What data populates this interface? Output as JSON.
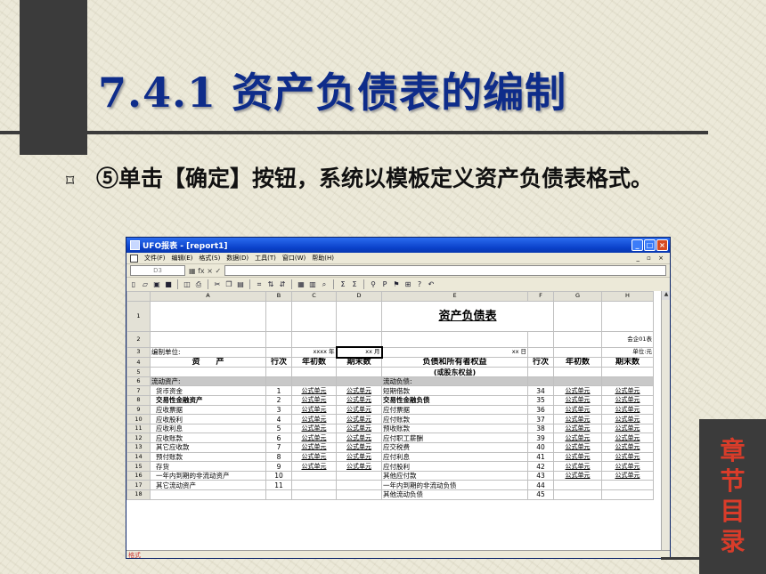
{
  "slide": {
    "title": "7.4.1 资产负债表的编制",
    "bullet_symbol": "⌑",
    "bullet_text": "⑤单击【确定】按钮，系统以模板定义资产负债表格式。",
    "chapter_nav": [
      "章",
      "节",
      "目",
      "录"
    ]
  },
  "app": {
    "title": "UFO报表 - [report1]",
    "menu": [
      "文件(F)",
      "编辑(E)",
      "格式(S)",
      "数据(D)",
      "工具(T)",
      "窗口(W)",
      "帮助(H)"
    ],
    "mdi_controls": "_ ▫ ×",
    "cell_ref": "D3",
    "fx_symbols": "▦ fx × ✓",
    "columns": [
      "A",
      "B",
      "C",
      "D",
      "E",
      "F",
      "G",
      "H"
    ],
    "report_title": "资产负债表",
    "form_code": "会企01表",
    "unit_label": "编制单位:",
    "year_label": "xxxx 年",
    "month_label": "xx 月",
    "day_label": "xx 日",
    "currency_unit": "单位:元",
    "headers": [
      "资　　产",
      "行次",
      "年初数",
      "期末数",
      "负债和所有者权益",
      "行次",
      "年初数",
      "期末数"
    ],
    "header_sub": "(或股东权益)",
    "section_left": "流动资产:",
    "section_right": "流动负债:",
    "formula": "公式单元",
    "rows": [
      {
        "n": "7",
        "a": "货币资金",
        "b": "1",
        "e": "短期借款",
        "f": "34"
      },
      {
        "n": "8",
        "a": "交易性金融资产",
        "b": "2",
        "e": "交易性金融负债",
        "f": "35",
        "bold": true
      },
      {
        "n": "9",
        "a": "应收票据",
        "b": "3",
        "e": "应付票据",
        "f": "36"
      },
      {
        "n": "10",
        "a": "应收股利",
        "b": "4",
        "e": "应付账款",
        "f": "37"
      },
      {
        "n": "11",
        "a": "应收利息",
        "b": "5",
        "e": "预收账款",
        "f": "38"
      },
      {
        "n": "12",
        "a": "应收账款",
        "b": "6",
        "e": "应付职工薪酬",
        "f": "39"
      },
      {
        "n": "13",
        "a": "其它应收款",
        "b": "7",
        "e": "应交税费",
        "f": "40"
      },
      {
        "n": "14",
        "a": "预付账款",
        "b": "8",
        "e": "应付利息",
        "f": "41"
      },
      {
        "n": "15",
        "a": "存货",
        "b": "9",
        "e": "应付股利",
        "f": "42"
      },
      {
        "n": "16",
        "a": "一年内到期的非流动资产",
        "b": "10",
        "e": "其他应付款",
        "f": "43"
      },
      {
        "n": "17",
        "a": "其它流动资产",
        "b": "11",
        "e": "一年内到期的非流动负债",
        "f": "44"
      },
      {
        "n": "18",
        "a": "",
        "b": "",
        "e": "其他流动负债",
        "f": "45"
      }
    ],
    "status_mode": "格式"
  }
}
